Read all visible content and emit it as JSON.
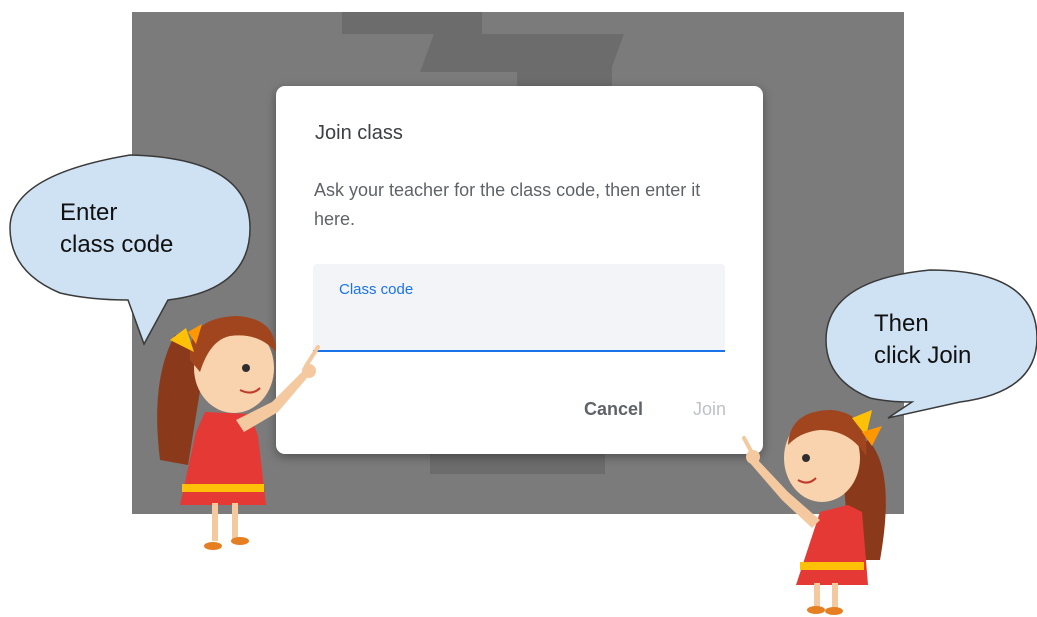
{
  "dialog": {
    "title": "Join class",
    "description": "Ask your teacher for the class code, then enter it here.",
    "field_label": "Class code",
    "field_value": "",
    "cancel_label": "Cancel",
    "join_label": "Join"
  },
  "callouts": {
    "left": {
      "line1": "Enter",
      "line2": "class code"
    },
    "right": {
      "line1": "Then",
      "line2": "click Join"
    }
  },
  "colors": {
    "accent": "#1a73e8",
    "backdrop": "#7b7b7b",
    "bubble_fill": "#cfe2f3",
    "bubble_stroke": "#3a3a3a"
  },
  "illustrations": [
    "cartoon-girl-pointing-left",
    "cartoon-girl-pointing-right"
  ]
}
